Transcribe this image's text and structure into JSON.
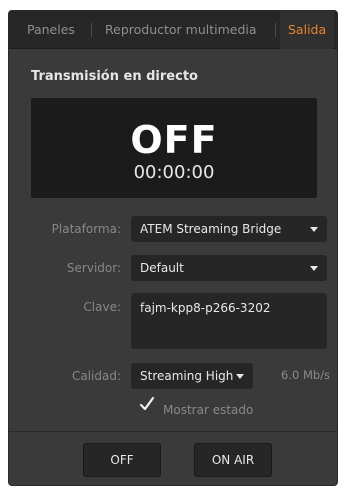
{
  "tabs": [
    {
      "label": "Paneles",
      "active": false
    },
    {
      "label": "Reproductor multimedia",
      "active": false
    },
    {
      "label": "Salida",
      "active": true
    }
  ],
  "section_title": "Transmisión en directo",
  "monitor": {
    "status": "OFF",
    "timer": "00:00:00"
  },
  "form": {
    "platform_label": "Plataforma:",
    "platform_value": "ATEM Streaming Bridge",
    "server_label": "Servidor:",
    "server_value": "Default",
    "key_label": "Clave:",
    "key_value": "fajm-kpp8-p266-3202",
    "quality_label": "Calidad:",
    "quality_value": "Streaming High",
    "bitrate": "6.0 Mb/s"
  },
  "show_status": {
    "label": "Mostrar estado",
    "checked": true
  },
  "buttons": {
    "off": "OFF",
    "on_air": "ON AIR"
  },
  "colors": {
    "accent": "#e8832c",
    "panel_bg": "#3a3a3a",
    "field_bg": "#262626"
  },
  "icons": {
    "checkmark": "checkmark-icon",
    "dropdown": "chevron-down-icon"
  }
}
